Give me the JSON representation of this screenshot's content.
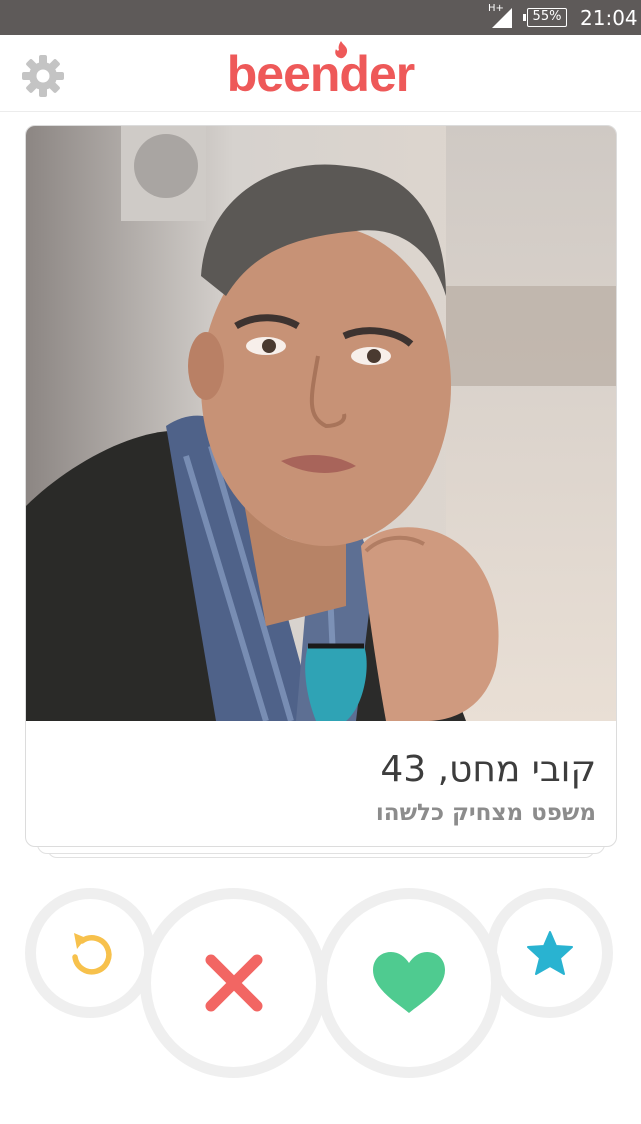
{
  "status_bar": {
    "network_type": "H+",
    "battery": "55%",
    "time": "21:04"
  },
  "header": {
    "logo": "beender",
    "settings_icon": "gear-icon"
  },
  "profile": {
    "name_age": "קובי מחט, 43",
    "bio": "משפט מצחיק כלשהו"
  },
  "actions": [
    {
      "name": "undo-button",
      "icon": "undo-arrow-icon",
      "color": "#f7c14c"
    },
    {
      "name": "nope-button",
      "icon": "x-icon",
      "color": "#f26663"
    },
    {
      "name": "like-button",
      "icon": "heart-icon",
      "color": "#4fcb90"
    },
    {
      "name": "super-like-button",
      "icon": "star-icon",
      "color": "#29b3d1"
    }
  ],
  "colors": {
    "brand": "#ee5959",
    "status_bar": "#5e5a59"
  }
}
